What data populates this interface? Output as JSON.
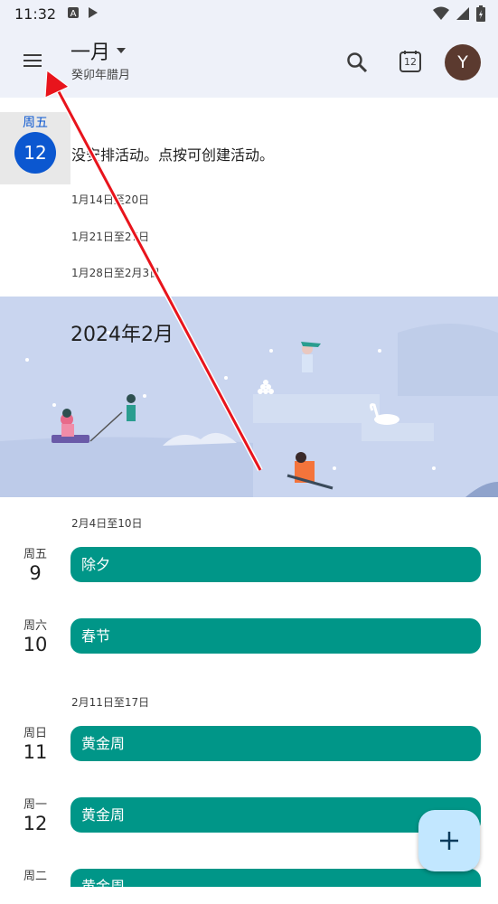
{
  "status_bar": {
    "time": "11:32",
    "left_icons": [
      "a-icon",
      "play-icon"
    ],
    "right_icons": [
      "wifi-icon",
      "signal-icon",
      "battery-icon"
    ]
  },
  "header": {
    "month": "一月",
    "lunar": "癸卯年腊月",
    "today_icon_day": "12",
    "avatar_letter": "Y"
  },
  "today": {
    "dow": "周五",
    "day": "12",
    "message": "没安排活动。点按可创建活动。"
  },
  "upcoming_weeks": [
    "1月14日至20日",
    "1月21日至27日",
    "1月28日至2月3日"
  ],
  "banner": {
    "title": "2024年2月"
  },
  "week_feb_1": "2月4日至10日",
  "week_feb_2": "2月11日至17日",
  "days": [
    {
      "dow": "周五",
      "day": "9",
      "event": "除夕"
    },
    {
      "dow": "周六",
      "day": "10",
      "event": "春节"
    },
    {
      "dow": "周日",
      "day": "11",
      "event": "黄金周"
    },
    {
      "dow": "周一",
      "day": "12",
      "event": "黄金周"
    },
    {
      "dow": "周二",
      "day": "",
      "event": "黄金周"
    }
  ],
  "colors": {
    "accent": "#0b57d0",
    "event": "#009688",
    "banner": "#c9d5ef",
    "annotation_arrow": "#e8141c"
  }
}
